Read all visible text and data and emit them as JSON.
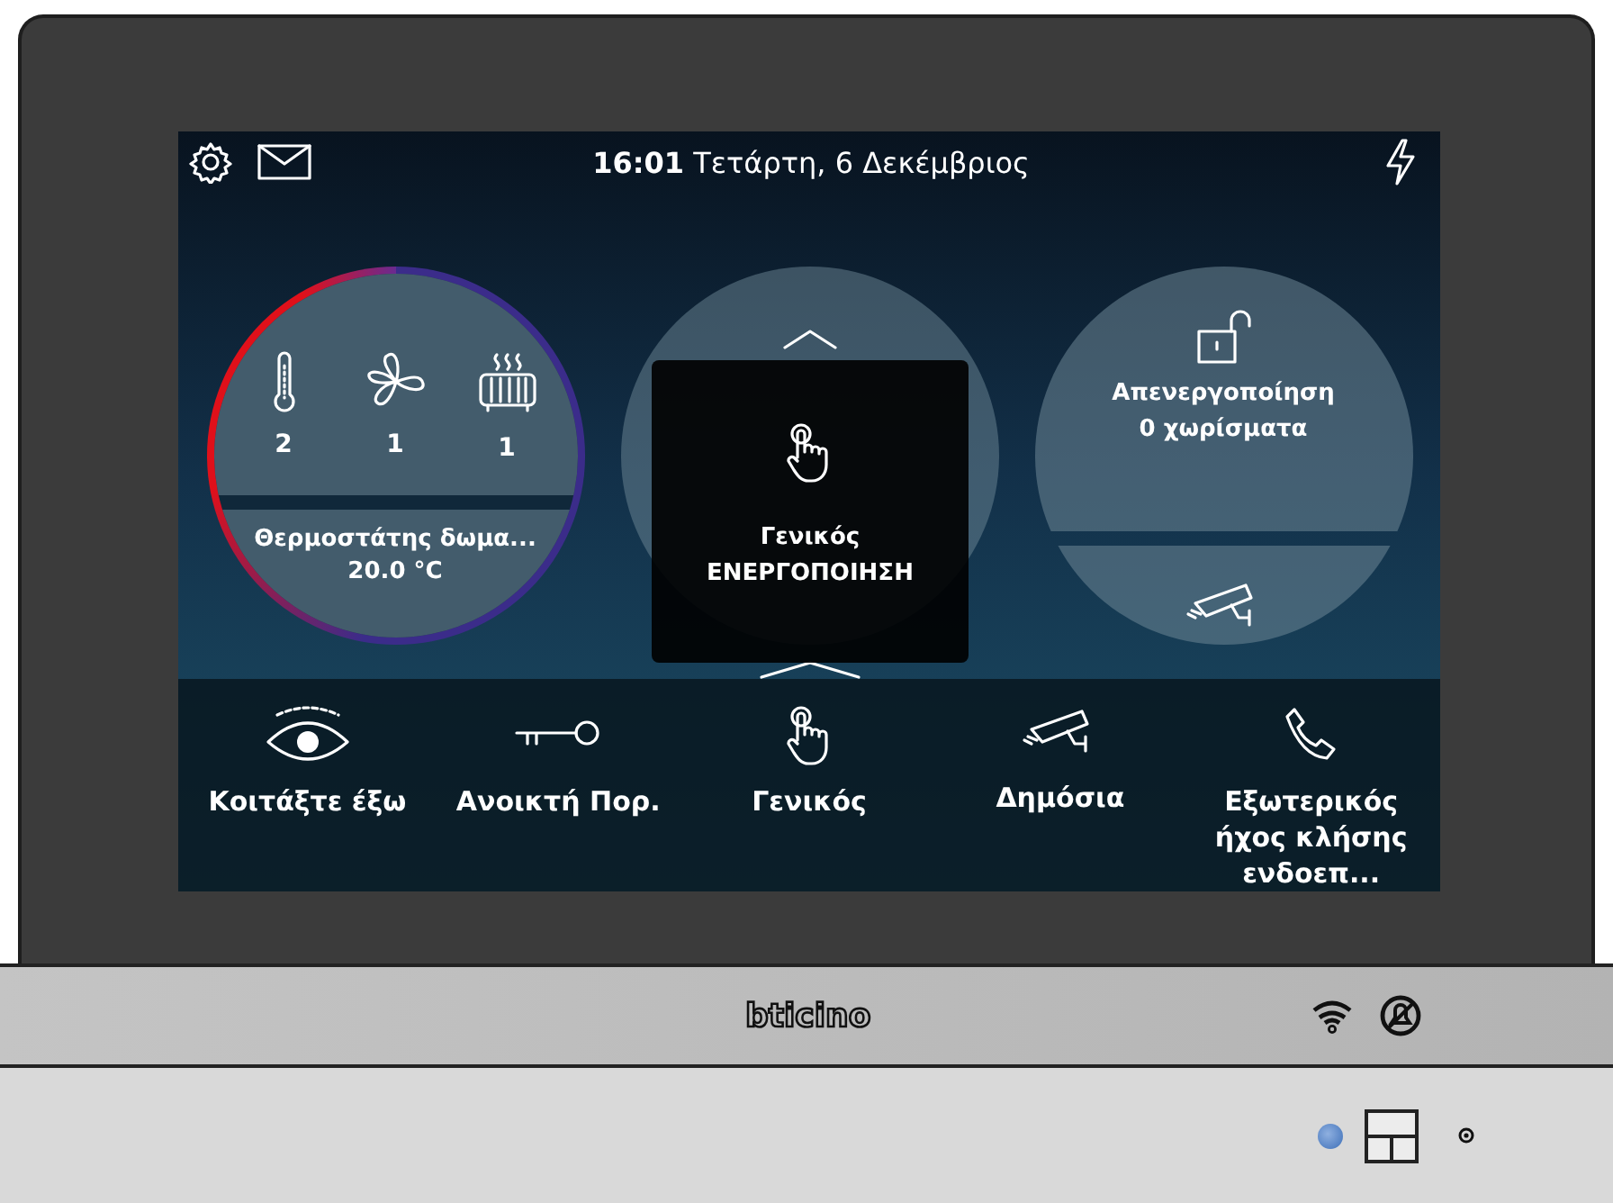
{
  "status_bar": {
    "time": "16:01",
    "date": "Τετάρτη, 6 Δεκέμβριος"
  },
  "thermostat": {
    "counts": [
      {
        "kind": "thermometer",
        "value": "2"
      },
      {
        "kind": "fan",
        "value": "1"
      },
      {
        "kind": "heater",
        "value": "1"
      }
    ],
    "name": "Θερμοστάτης δωμα...",
    "temperature": "20.0 °C"
  },
  "scenario_popup": {
    "title": "Γενικός",
    "action": "ΕΝΕΡΓΟΠΟΙΗΣΗ"
  },
  "alarm": {
    "status": "Απενεργοποίηση",
    "zones": "0 χωρίσματα"
  },
  "favourites": [
    {
      "kind": "eye",
      "label": "Κοιτάξτε έξω"
    },
    {
      "kind": "key",
      "label": "Ανοικτή Πορ."
    },
    {
      "kind": "hand",
      "label": "Γενικός"
    },
    {
      "kind": "camera",
      "label": "Δημόσια"
    },
    {
      "kind": "phone",
      "label": "Εξωτερικός ήχος κλήσης ενδοεπ..."
    }
  ],
  "device": {
    "brand": "bticino"
  }
}
